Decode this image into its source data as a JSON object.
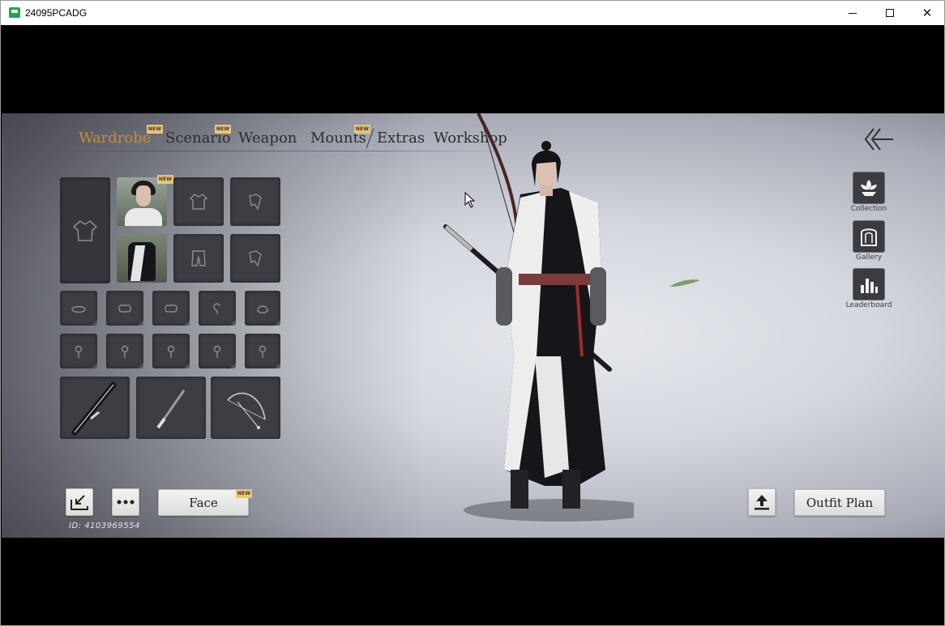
{
  "window": {
    "title": "24095PCADG",
    "controls": {
      "minimize": "minimize",
      "maximize": "maximize",
      "close": "✕"
    }
  },
  "tabs": [
    {
      "label": "Wardrobe",
      "new": true,
      "active": true
    },
    {
      "label": "Scenario",
      "new": true,
      "active": false
    },
    {
      "label": "Weapon",
      "new": false,
      "active": false
    },
    {
      "label": "Mounts",
      "new": true,
      "active": false
    },
    {
      "label": "Extras",
      "new": false,
      "active": false
    },
    {
      "label": "Workshop",
      "new": false,
      "active": false
    }
  ],
  "badge_text": "NEW",
  "sidebar": {
    "items": [
      {
        "label": "Collection",
        "icon": "lotus-icon"
      },
      {
        "label": "Gallery",
        "icon": "gallery-icon"
      },
      {
        "label": "Leaderboard",
        "icon": "bar-chart-icon"
      }
    ]
  },
  "bottom": {
    "face_label": "Face",
    "outfit_plan_label": "Outfit Plan",
    "id_text": "ID: 4103969554"
  },
  "colors": {
    "accent": "#c98a3a",
    "badge": "#e6c47f",
    "slot": "#3c3e44",
    "text": "#2b2d33"
  }
}
